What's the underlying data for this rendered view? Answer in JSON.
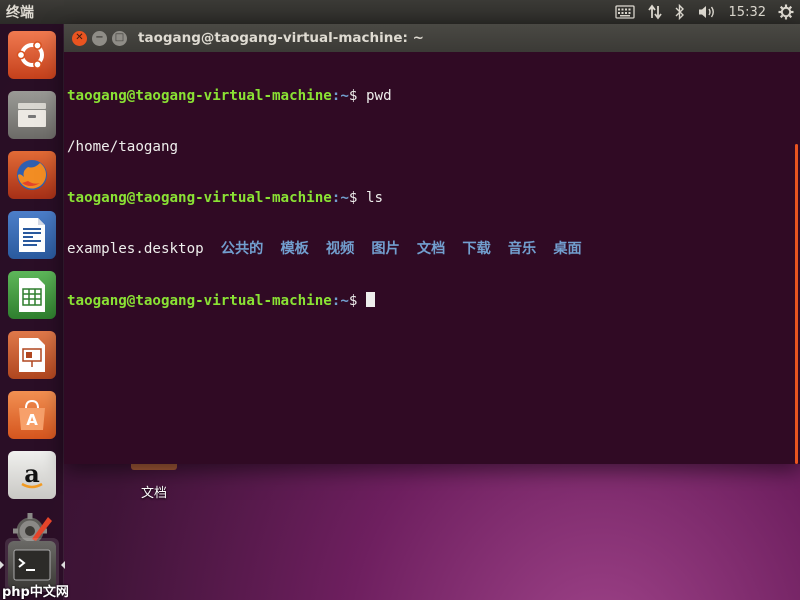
{
  "top_panel": {
    "app_name": "终端",
    "clock": "15:32",
    "indicators": [
      "keyboard-icon",
      "network-icon",
      "bluetooth-icon",
      "volume-icon",
      "gear-icon"
    ]
  },
  "launcher": {
    "items": [
      "ubuntu-logo-icon",
      "files-icon",
      "firefox-icon",
      "writer-icon",
      "calc-icon",
      "impress-icon",
      "software-center-icon",
      "amazon-icon",
      "system-settings-icon",
      "terminal-icon"
    ]
  },
  "terminal": {
    "title": "taogang@taogang-virtual-machine: ~",
    "prompt_user": "taogang@taogang-virtual-machine",
    "prompt_path": ":~",
    "prompt_symbol": "$ ",
    "lines": {
      "cmd1": "pwd",
      "out1": "/home/taogang",
      "cmd2": "ls",
      "file1": "examples.desktop",
      "dirs": [
        "公共的",
        "模板",
        "视频",
        "图片",
        "文档",
        "下载",
        "音乐",
        "桌面"
      ]
    },
    "colors": {
      "background": "#300a24",
      "user": "#8ae234",
      "path": "#729fcf",
      "cursor": "#eeeeec"
    }
  },
  "desktop": {
    "icon_label": "文档"
  },
  "watermark": "php中文网"
}
